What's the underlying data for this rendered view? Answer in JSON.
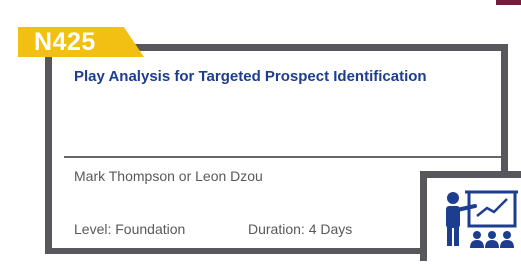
{
  "badge": {
    "code": "N425",
    "color": "#f2c012"
  },
  "course": {
    "title": "Play Analysis for Targeted Prospect Identification",
    "title_color": "#1d3d8f",
    "instructors": "Mark Thompson or Leon Dzou",
    "level": "Level: Foundation",
    "duration": "Duration: 4 Days"
  },
  "frame": {
    "border_color": "#58585c",
    "accent_color": "#6d1f3c"
  },
  "icon": {
    "name": "classroom-presentation-icon",
    "color": "#1d3d8f"
  }
}
